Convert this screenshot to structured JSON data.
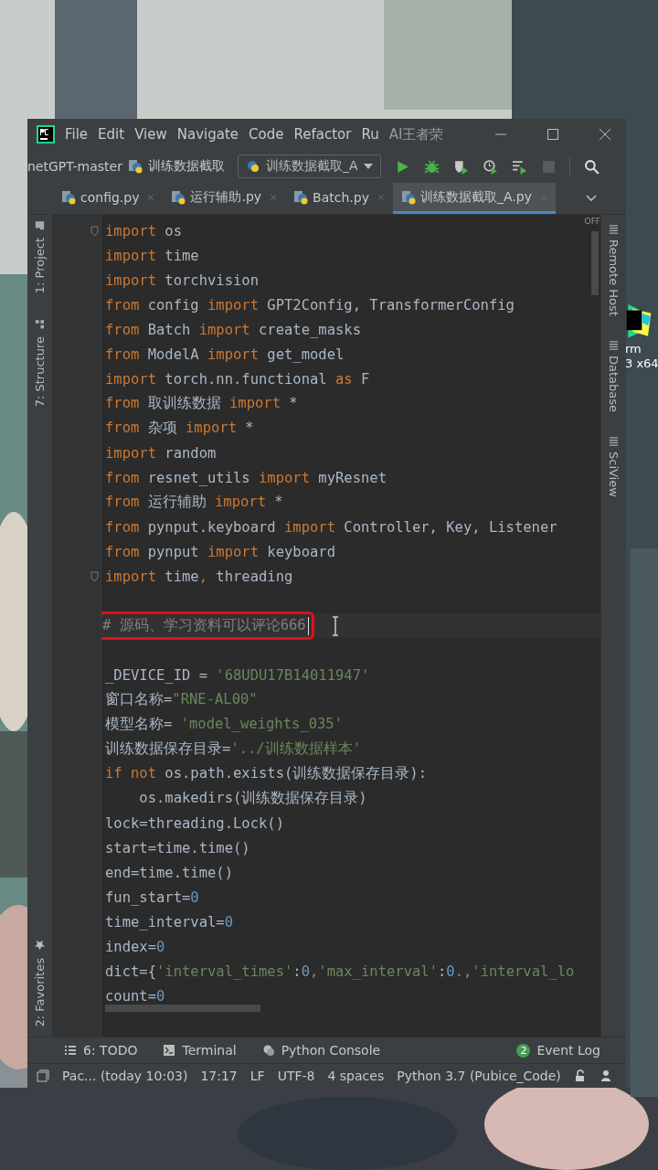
{
  "window": {
    "menu": [
      "File",
      "Edit",
      "View",
      "Navigate",
      "Code",
      "Refactor",
      "Ru",
      "AI王者荣"
    ]
  },
  "navbar": {
    "breadcrumbs": [
      "netGPT-master",
      "训练数据截取"
    ],
    "run_config": "训练数据截取_A"
  },
  "tabs": [
    {
      "label": "config.py",
      "selected": false
    },
    {
      "label": "运行辅助.py",
      "selected": false
    },
    {
      "label": "Batch.py",
      "selected": false
    },
    {
      "label": "训练数据截取_A.py",
      "selected": true
    }
  ],
  "left_tools": [
    {
      "label": "1: Project",
      "kind": "folder"
    },
    {
      "label": "7: Structure",
      "kind": "structure"
    }
  ],
  "left_bottom_tools": [
    {
      "label": "2: Favorites",
      "kind": "star"
    }
  ],
  "right_tools": [
    "Remote Host",
    "Database",
    "SciView"
  ],
  "inspection": "OFF",
  "code": [
    {
      "fold": true,
      "tokens": [
        {
          "kind": "kw",
          "text": "import"
        },
        {
          "kind": "id",
          "text": " os"
        }
      ]
    },
    {
      "tokens": [
        {
          "kind": "kw",
          "text": "import"
        },
        {
          "kind": "id",
          "text": " time"
        }
      ]
    },
    {
      "tokens": [
        {
          "kind": "kw",
          "text": "import"
        },
        {
          "kind": "id",
          "text": " torchvision"
        }
      ]
    },
    {
      "tokens": [
        {
          "kind": "kw",
          "text": "from"
        },
        {
          "kind": "id",
          "text": " config "
        },
        {
          "kind": "kw",
          "text": "import"
        },
        {
          "kind": "id",
          "text": " GPT2Config, TransformerConfig"
        }
      ]
    },
    {
      "tokens": [
        {
          "kind": "kw",
          "text": "from"
        },
        {
          "kind": "id",
          "text": " Batch "
        },
        {
          "kind": "kw",
          "text": "import"
        },
        {
          "kind": "id",
          "text": " create_masks"
        }
      ]
    },
    {
      "tokens": [
        {
          "kind": "kw",
          "text": "from"
        },
        {
          "kind": "id",
          "text": " ModelA "
        },
        {
          "kind": "kw",
          "text": "import"
        },
        {
          "kind": "id",
          "text": " get_model"
        }
      ]
    },
    {
      "tokens": [
        {
          "kind": "kw",
          "text": "import"
        },
        {
          "kind": "id",
          "text": " torch.nn.functional "
        },
        {
          "kind": "kw",
          "text": "as"
        },
        {
          "kind": "id",
          "text": " F"
        }
      ]
    },
    {
      "tokens": [
        {
          "kind": "kw",
          "text": "from"
        },
        {
          "kind": "id",
          "text": " 取训练数据 "
        },
        {
          "kind": "kw",
          "text": "import"
        },
        {
          "kind": "id",
          "text": " *"
        }
      ]
    },
    {
      "tokens": [
        {
          "kind": "kw",
          "text": "from"
        },
        {
          "kind": "id",
          "text": " 杂项 "
        },
        {
          "kind": "kw",
          "text": "import"
        },
        {
          "kind": "id",
          "text": " *"
        }
      ]
    },
    {
      "tokens": [
        {
          "kind": "kw",
          "text": "import"
        },
        {
          "kind": "id",
          "text": " random"
        }
      ]
    },
    {
      "tokens": [
        {
          "kind": "kw",
          "text": "from"
        },
        {
          "kind": "id",
          "text": " resnet_utils "
        },
        {
          "kind": "kw",
          "text": "import"
        },
        {
          "kind": "id",
          "text": " myResnet"
        }
      ]
    },
    {
      "tokens": [
        {
          "kind": "kw",
          "text": "from"
        },
        {
          "kind": "id",
          "text": " 运行辅助 "
        },
        {
          "kind": "kw",
          "text": "import"
        },
        {
          "kind": "id",
          "text": " *"
        }
      ]
    },
    {
      "tokens": [
        {
          "kind": "kw",
          "text": "from"
        },
        {
          "kind": "id",
          "text": " pynput.keyboard "
        },
        {
          "kind": "kw",
          "text": "import"
        },
        {
          "kind": "id",
          "text": " Controller, Key, Listener"
        }
      ]
    },
    {
      "tokens": [
        {
          "kind": "kw",
          "text": "from"
        },
        {
          "kind": "id",
          "text": " pynput "
        },
        {
          "kind": "kw",
          "text": "import"
        },
        {
          "kind": "id",
          "text": " keyboard"
        }
      ]
    },
    {
      "fold": true,
      "tokens": [
        {
          "kind": "kw",
          "text": "import"
        },
        {
          "kind": "id",
          "text": " time"
        },
        {
          "kind": "kw",
          "text": ","
        },
        {
          "kind": "id",
          "text": " threading"
        }
      ]
    },
    {
      "kind": "blank"
    },
    {
      "current": true,
      "boxed": true,
      "tokens": [
        {
          "kind": "comment",
          "text": "# 源码、学习资料可以评论666"
        }
      ]
    },
    {
      "kind": "blank"
    },
    {
      "tokens": [
        {
          "kind": "id",
          "text": "_DEVICE_ID = "
        },
        {
          "kind": "str",
          "text": "'68UDU17B14011947'"
        }
      ]
    },
    {
      "tokens": [
        {
          "kind": "id",
          "text": "窗口名称="
        },
        {
          "kind": "str",
          "text": "\"RNE-AL00\""
        }
      ]
    },
    {
      "tokens": [
        {
          "kind": "id",
          "text": "模型名称= "
        },
        {
          "kind": "str",
          "text": "'model_weights_035'"
        }
      ]
    },
    {
      "tokens": [
        {
          "kind": "id",
          "text": "训练数据保存目录="
        },
        {
          "kind": "str",
          "text": "'../训练数据样本'"
        }
      ]
    },
    {
      "tokens": [
        {
          "kind": "kw",
          "text": "if not"
        },
        {
          "kind": "id",
          "text": " os.path.exists(训练数据保存目录):"
        }
      ]
    },
    {
      "tokens": [
        {
          "kind": "id",
          "text": "    os.makedirs(训练数据保存目录)"
        }
      ]
    },
    {
      "tokens": [
        {
          "kind": "id",
          "text": "lock=threading.Lock()"
        }
      ]
    },
    {
      "tokens": [
        {
          "kind": "id",
          "text": "start=time.time()"
        }
      ]
    },
    {
      "tokens": [
        {
          "kind": "id",
          "text": "end=time.time()"
        }
      ]
    },
    {
      "tokens": [
        {
          "kind": "id",
          "text": "fun_start="
        },
        {
          "kind": "num",
          "text": "0"
        }
      ]
    },
    {
      "tokens": [
        {
          "kind": "id",
          "text": "time_interval="
        },
        {
          "kind": "num",
          "text": "0"
        }
      ]
    },
    {
      "tokens": [
        {
          "kind": "id",
          "text": "index="
        },
        {
          "kind": "num",
          "text": "0"
        }
      ]
    },
    {
      "tokens": [
        {
          "kind": "id",
          "text": "dict={"
        },
        {
          "kind": "str",
          "text": "'interval_times'"
        },
        {
          "kind": "id",
          "text": ":"
        },
        {
          "kind": "num",
          "text": "0"
        },
        {
          "kind": "kw",
          "text": ","
        },
        {
          "kind": "str",
          "text": "'max_interval'"
        },
        {
          "kind": "id",
          "text": ":"
        },
        {
          "kind": "num",
          "text": "0."
        },
        {
          "kind": "kw",
          "text": ","
        },
        {
          "kind": "str",
          "text": "'interval_lo"
        }
      ]
    },
    {
      "tokens": [
        {
          "kind": "id",
          "text": "count="
        },
        {
          "kind": "num",
          "text": "0"
        }
      ]
    }
  ],
  "tool_windows": [
    {
      "label": "6: TODO",
      "kind": "list"
    },
    {
      "label": "Terminal",
      "kind": "terminal"
    },
    {
      "label": "Python Console",
      "kind": "python"
    }
  ],
  "event_log": {
    "count": "2",
    "label": "Event Log"
  },
  "status_bar": [
    "Pac... (today 10:03)",
    "17:17",
    "LF",
    "UTF-8",
    "4 spaces",
    "Python 3.7 (Pubice_Code)"
  ],
  "desktop_icon": {
    "lines": [
      "rm",
      "3 x64"
    ]
  }
}
